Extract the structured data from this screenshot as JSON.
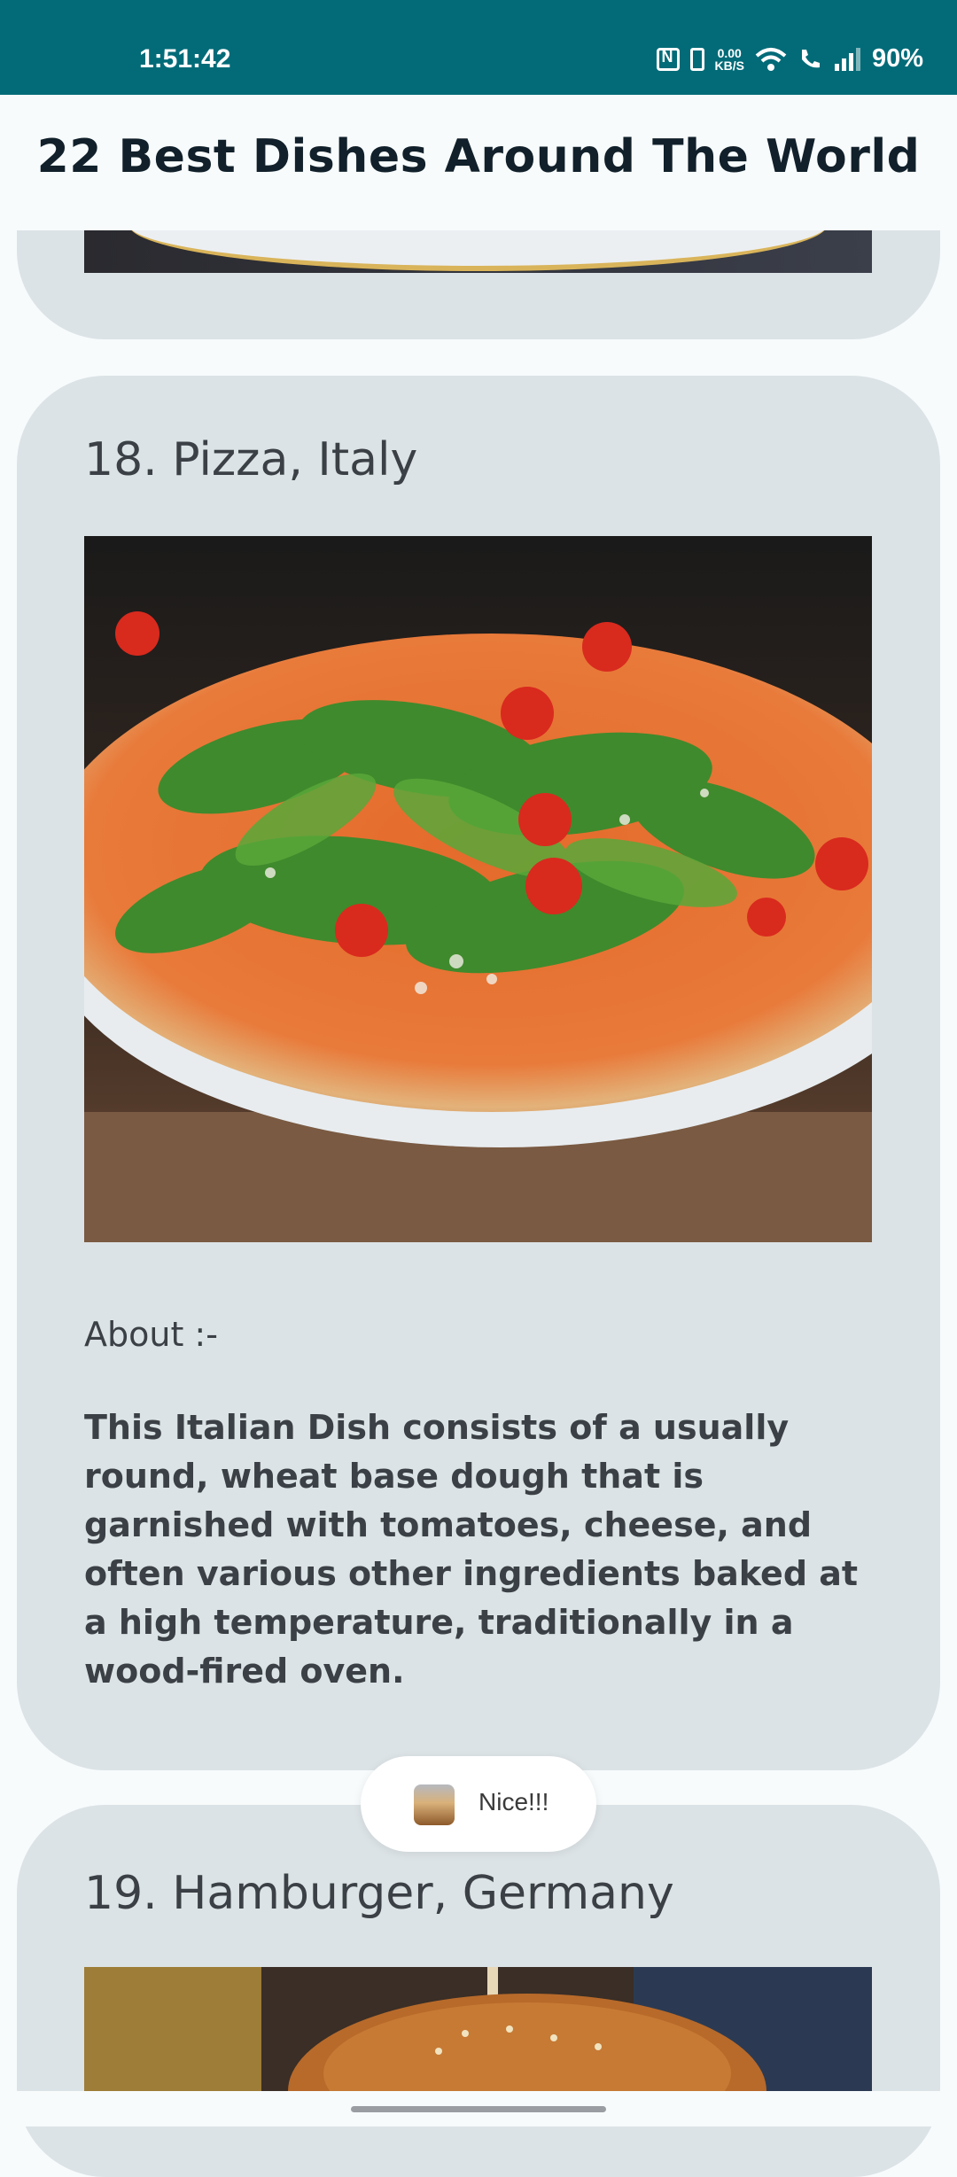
{
  "status_bar": {
    "time": "1:51:42",
    "speed_value": "0.00",
    "speed_unit": "KB/S",
    "battery": "90%",
    "icons": [
      "nfc-icon",
      "vibrate-icon",
      "wifi-icon",
      "call-icon",
      "signal-icon"
    ],
    "background_color": "#036b78"
  },
  "app_bar": {
    "title": "22 Best Dishes Around The World"
  },
  "cards": [
    {
      "title": "18. Pizza, Italy",
      "about_label": "About :-",
      "about_text": "This Italian Dish consists of a usually round, wheat base dough that is garnished with tomatoes, cheese, and often various other ingredients baked at a high temperature, traditionally in a wood-fired oven."
    },
    {
      "title": "19. Hamburger, Germany"
    }
  ],
  "toast": {
    "text": "Nice!!!"
  },
  "colors": {
    "card_background": "#dce3e6",
    "page_background": "#f7fbfc",
    "text": "#3a4045"
  }
}
